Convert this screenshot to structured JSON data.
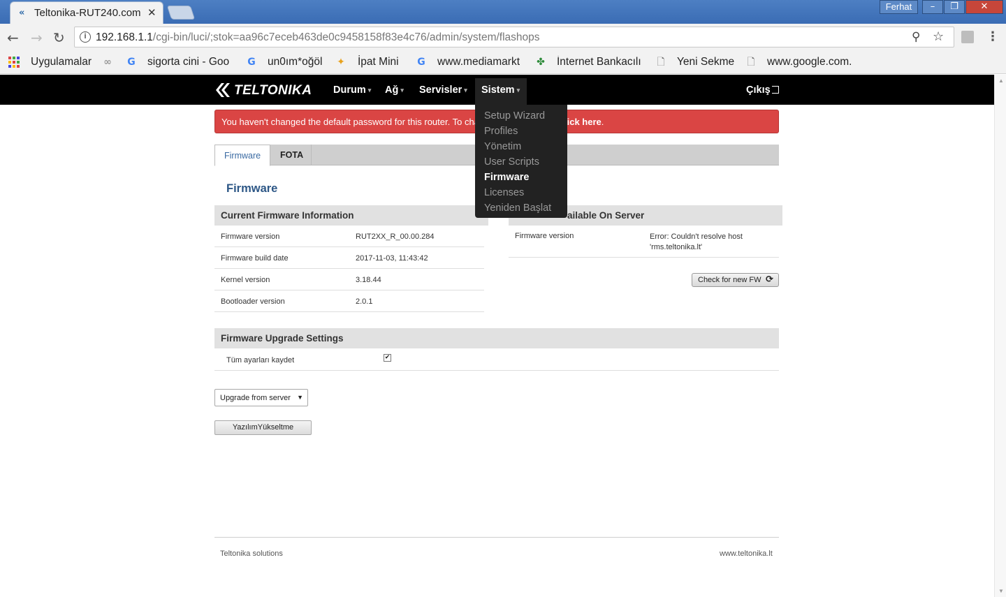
{
  "browser": {
    "tab_title": "Teltonika-RUT240.com",
    "tab_close": "✕",
    "user_name": "Ferhat",
    "url_host": "192.168.1.1",
    "url_path": "/cgi-bin/luci/;stok=aa96c7eceb463de0c9458158f83e4c76/admin/system/flashops",
    "bookmarks": [
      {
        "label": "Uygulamalar",
        "icon": "apps-icon"
      },
      {
        "label": "",
        "icon": "glasses-icon"
      },
      {
        "label": "sigorta cini - Goo",
        "icon": "google-icon"
      },
      {
        "label": "un0ım*oğöl",
        "icon": "google-icon"
      },
      {
        "label": "İpat Mini",
        "icon": "pinwheel-icon"
      },
      {
        "label": "www.mediamarkt",
        "icon": "google-icon"
      },
      {
        "label": "İnternet Bankacılı",
        "icon": "clover-icon"
      },
      {
        "label": "Yeni Sekme",
        "icon": "page-icon"
      },
      {
        "label": "www.google.com.",
        "icon": "page-icon"
      }
    ]
  },
  "router": {
    "brand": "TELTONIKA",
    "nav": [
      "Durum",
      "Ağ",
      "Servisler",
      "Sistem"
    ],
    "logout": "Çıkış",
    "alert_text_start": "You haven't changed the default password for this router. To cha",
    "alert_link": "lick here",
    "alert_end": ".",
    "tabs": [
      "Firmware",
      "FOTA"
    ],
    "page_title": "Firmware",
    "current_section_title": "Current Firmware Information",
    "current_info": [
      {
        "key": "Firmware version",
        "value": "RUT2XX_R_00.00.284"
      },
      {
        "key": "Firmware build date",
        "value": "2017-11-03, 11:43:42"
      },
      {
        "key": "Kernel version",
        "value": "3.18.44"
      },
      {
        "key": "Bootloader version",
        "value": "2.0.1"
      }
    ],
    "server_section_title": "ailable On Server",
    "server_key": "Firmware version",
    "server_value": "Error: Couldn't resolve host 'rms.teltonika.lt'",
    "check_button": "Check for new FW",
    "upgrade_section_title": "Firmware Upgrade Settings",
    "keep_settings_label": "Tüm ayarları kaydet",
    "keep_settings_checked": true,
    "upgrade_source": "Upgrade from server",
    "upgrade_button": "YazılımYükseltme",
    "footer_left": "Teltonika solutions",
    "footer_right": "www.teltonika.lt",
    "dropdown_items": [
      {
        "label": "Setup Wizard",
        "active": false
      },
      {
        "label": "Profiles",
        "active": false
      },
      {
        "label": "Yönetim",
        "active": false
      },
      {
        "label": "User Scripts",
        "active": false
      },
      {
        "label": "Firmware",
        "active": true
      },
      {
        "label": "Licenses",
        "active": false
      },
      {
        "label": "Yeniden Başlat",
        "active": false
      }
    ]
  }
}
